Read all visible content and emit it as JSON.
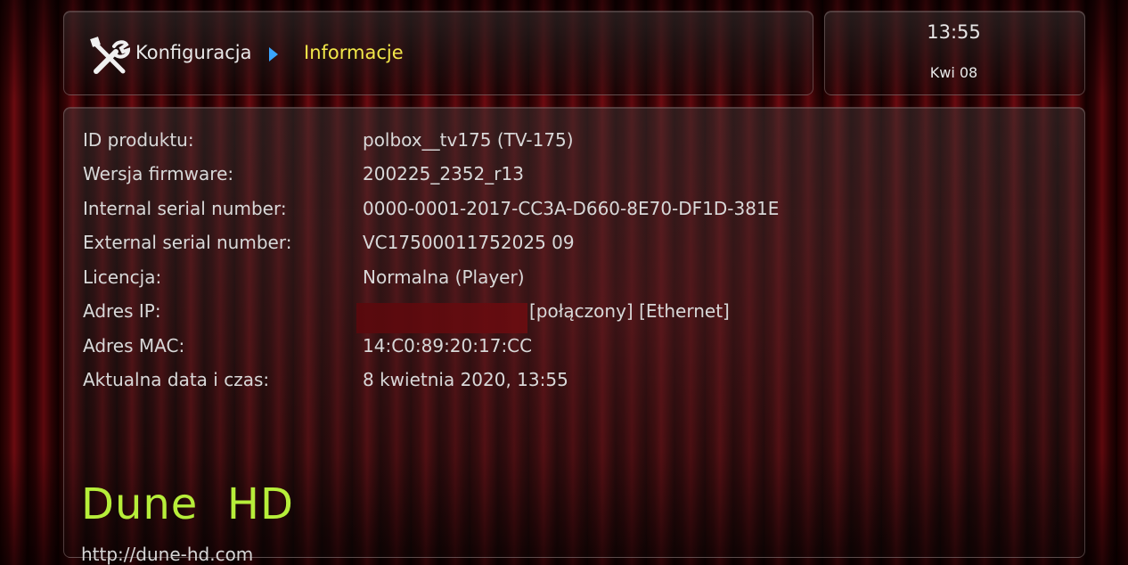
{
  "header": {
    "icon": "tools-icon",
    "breadcrumb_root": "Konfiguracja",
    "breadcrumb_current": "Informacje",
    "accent_color": "#f2e84a",
    "separator_color": "#3aa6ff"
  },
  "clock": {
    "time": "13:55",
    "date": "Kwi 08"
  },
  "info": {
    "rows": [
      {
        "label": "ID produktu:",
        "value": "polbox__tv175 (TV-175)"
      },
      {
        "label": "Wersja firmware:",
        "value": "200225_2352_r13"
      },
      {
        "label": "Internal serial number:",
        "value": "0000-0001-2017-CC3A-D660-8E70-DF1D-381E"
      },
      {
        "label": "External serial number:",
        "value": "VC17500011752025 09"
      },
      {
        "label": "Licencja:",
        "value": "Normalna (Player)"
      },
      {
        "label": "Adres IP:",
        "value": "[połączony] [Ethernet]"
      },
      {
        "label": "Adres MAC:",
        "value": "14:C0:89:20:17:CC"
      },
      {
        "label": "Aktualna data i czas:",
        "value": "8 kwietnia 2020, 13:55"
      }
    ]
  },
  "brand": {
    "name": "Dune  HD",
    "url": "http://dune-hd.com",
    "color": "#b7ee3a"
  }
}
